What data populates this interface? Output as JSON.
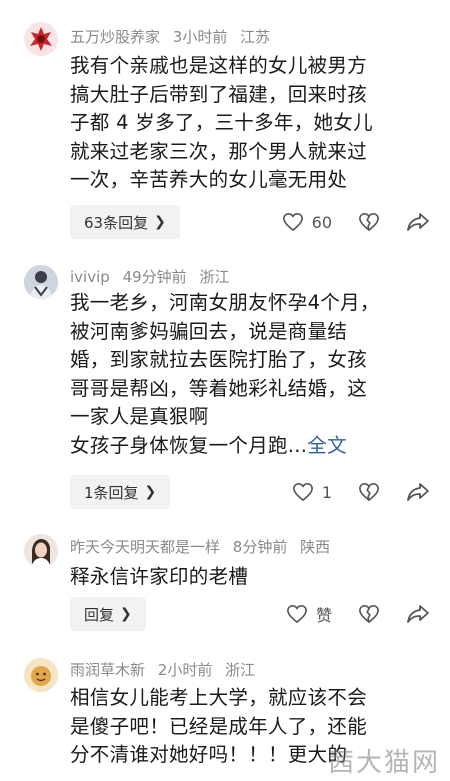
{
  "comments": [
    {
      "user": "五万炒股养家",
      "time": "3小时前",
      "location": "江苏",
      "lines": [
        "我有个亲戚也是这样的女儿被男方",
        "搞大肚子后带到了福建，回来时孩",
        "子都 4 岁多了，三十多年，她女儿",
        "就来过老家三次，那个男人就来过",
        "一次，辛苦养大的女儿毫无用处"
      ],
      "reply_label": "63条回复",
      "likes": "60"
    },
    {
      "user": "ivivip",
      "time": "49分钟前",
      "location": "浙江",
      "lines": [
        "我一老乡，河南女朋友怀孕4个月，",
        "被河南爹妈骗回去，说是商量结",
        "婚，到家就拉去医院打胎了，女孩",
        "哥哥是帮凶，等着她彩礼结婚，这",
        "一家人是真狠啊",
        "女孩子身体恢复一个月跑..."
      ],
      "full_text_label": "全文",
      "reply_label": "1条回复",
      "likes": "1"
    },
    {
      "user": "昨天今天明天都是一样",
      "time": "8分钟前",
      "location": "陕西",
      "lines": [
        "释永信许家印的老槽"
      ],
      "reply_label": "回复",
      "likes": "赞"
    },
    {
      "user": "雨润草木新",
      "time": "2小时前",
      "location": "浙江",
      "lines": [
        "相信女儿能考上大学，就应该不会",
        "是傻子吧！已经是成年人了，还能",
        "分不清谁对她好吗！！！更大的"
      ]
    }
  ],
  "watermark": "茜大猫网",
  "colors": {
    "meta": "#8a8a8a",
    "link": "#2f5f9e",
    "pill_bg": "#f2f2f2"
  }
}
